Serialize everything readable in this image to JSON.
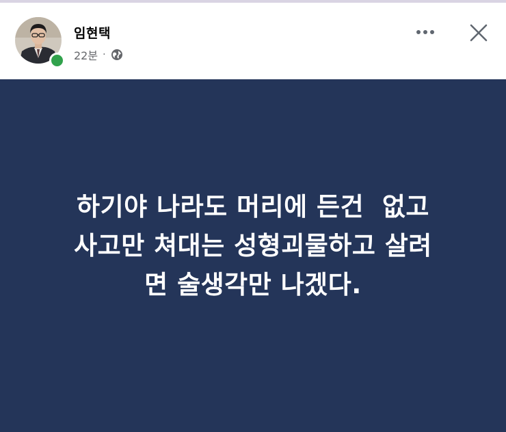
{
  "post": {
    "author": "임현택",
    "time": "22분",
    "separator": "·",
    "privacy_icon": "globe-icon",
    "text_lines": [
      "하기야 나라도 머리에 든건  없고",
      "사고만 쳐대는 성형괴물하고 살려",
      "면 술생각만 나겠다."
    ]
  },
  "actions": {
    "more_icon": "more-horizontal-icon",
    "close_icon": "close-icon"
  },
  "colors": {
    "card_background": "#243559",
    "text_on_card": "#ffffff",
    "online_indicator": "#31a24c",
    "meta_text": "#65676b"
  }
}
